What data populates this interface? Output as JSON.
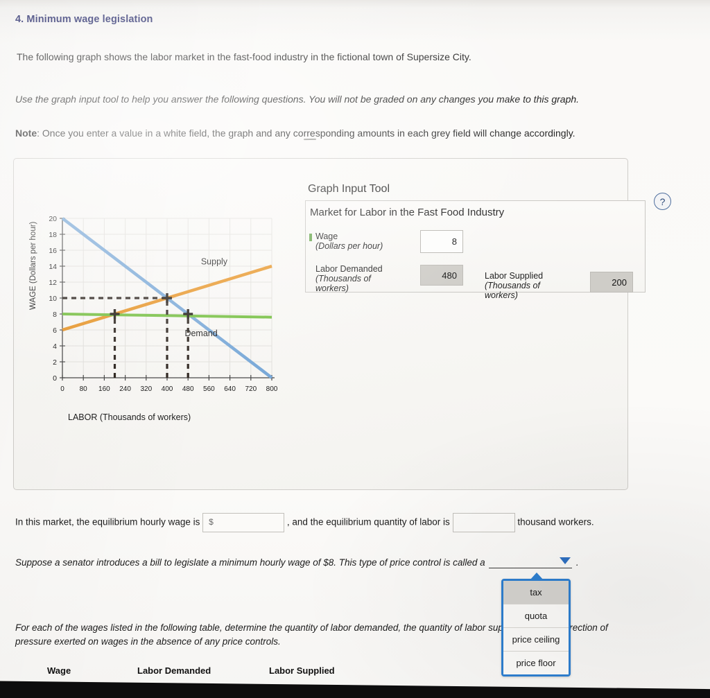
{
  "heading": "4. Minimum wage legislation",
  "paragraphs": {
    "intro": "The following graph shows the labor market in the fast-food industry in the fictional town of Supersize City.",
    "use_graph": "Use the graph input tool to help you answer the following questions. You will not be graded on any changes you make to this graph.",
    "note_label": "Note",
    "note_text": ": Once you enter a value in a white field, the graph and any corresponding amounts in each grey field will change accordingly."
  },
  "graph_input_tool": {
    "title": "Graph Input Tool",
    "subtitle": "Market for Labor in the Fast Food Industry",
    "help_icon": "?",
    "wage": {
      "label": "Wage",
      "sub_label": "(Dollars per hour)",
      "value": "8"
    },
    "labor_demanded": {
      "label": "Labor Demanded",
      "sub_label": "(Thousands of",
      "sub_label2": "workers)",
      "value": "480"
    },
    "labor_supplied": {
      "label": "Labor Supplied",
      "sub_label": "(Thousands of",
      "sub_label2": "workers)",
      "value": "200"
    }
  },
  "questions": {
    "q1_a": "In this market, the equilibrium hourly wage is",
    "q1_dollar": "$",
    "q1_wage_value": "",
    "q1_b": ", and the equilibrium quantity of labor is",
    "q1_qty_value": "",
    "q1_c": "thousand workers.",
    "q2": "Suppose a senator introduces a bill to legislate a minimum hourly wage of $8. This type of price control is called a",
    "q2_end": ".",
    "q3_a": "For each of the wages listed in the following table, determine the quantity of labor demanded, the quantity of labor supplied, and the direction of",
    "q3_b": "pressure exerted on wages in the absence of any price controls."
  },
  "dropdown": {
    "options": [
      "tax",
      "quota",
      "price ceiling",
      "price floor"
    ],
    "selected_index": 0
  },
  "table_headers": {
    "wage": "Wage",
    "labor_demanded": "Labor Demanded",
    "labor_supplied": "Labor Supplied"
  },
  "chart_data": {
    "type": "line",
    "title": "",
    "xlabel": "LABOR (Thousands of workers)",
    "ylabel": "WAGE (Dollars per hour)",
    "xlim": [
      0,
      800
    ],
    "ylim": [
      0,
      20
    ],
    "xticks": [
      0,
      80,
      160,
      240,
      320,
      400,
      480,
      560,
      640,
      720,
      800
    ],
    "yticks": [
      0,
      2,
      4,
      6,
      8,
      10,
      12,
      14,
      16,
      18,
      20
    ],
    "grid": true,
    "series": [
      {
        "name": "Demand",
        "color": "#7aa9d8",
        "label_pos": [
          530,
          5.2
        ],
        "points": [
          [
            0,
            20
          ],
          [
            800,
            0
          ]
        ]
      },
      {
        "name": "Supply",
        "color": "#e8972b",
        "label_pos": [
          580,
          14.2
        ],
        "points": [
          [
            0,
            6
          ],
          [
            800,
            14
          ]
        ]
      },
      {
        "name": "Minimum wage line",
        "color": "#77c043",
        "label_pos": null,
        "points": [
          [
            0,
            8
          ],
          [
            800,
            7.6
          ]
        ]
      }
    ],
    "markers": [
      {
        "x": 200,
        "y": 8,
        "label": "labor supplied at $8"
      },
      {
        "x": 400,
        "y": 10,
        "label": "equilibrium"
      },
      {
        "x": 480,
        "y": 8,
        "label": "labor demanded at $8"
      }
    ],
    "dashed_guides": [
      {
        "type": "horizontal",
        "y": 10,
        "from_x": 0,
        "to_x": 400
      },
      {
        "type": "vertical",
        "x": 200,
        "from_y": 0,
        "to_y": 8
      },
      {
        "type": "vertical",
        "x": 400,
        "from_y": 0,
        "to_y": 10
      },
      {
        "type": "vertical",
        "x": 480,
        "from_y": 0,
        "to_y": 8
      }
    ],
    "annotations": [
      {
        "text": "Supply",
        "x": 580,
        "y": 14.2
      },
      {
        "text": "Demand",
        "x": 530,
        "y": 5.2
      }
    ]
  }
}
